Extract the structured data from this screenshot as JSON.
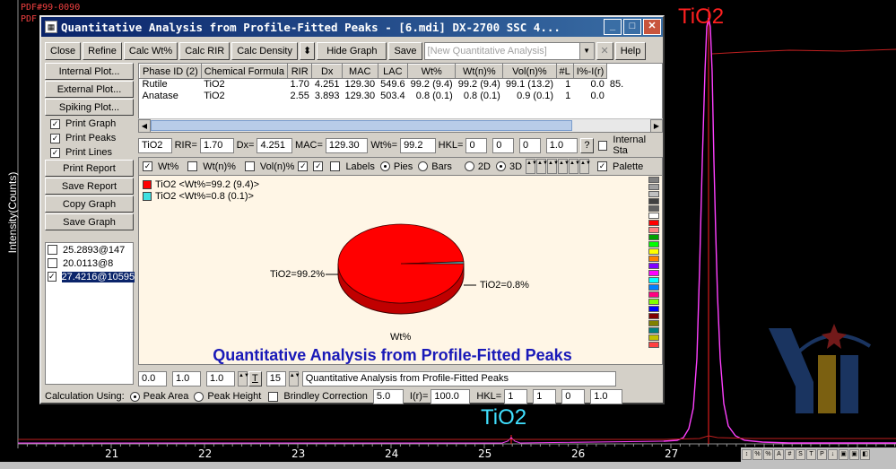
{
  "plot": {
    "pdf_label_1": "PDF#99-0090",
    "pdf_label_2": "PDF",
    "ylabel": "Intensity(Counts)",
    "peak_label_main": "TiO2",
    "peak_label_minor": "TiO2",
    "xticks": [
      "21",
      "22",
      "23",
      "24",
      "25",
      "26",
      "27"
    ],
    "colors": {
      "pattern": "#ff40ff",
      "peak_line": "#ff2020",
      "label_red": "#ff2020",
      "label_cyan": "#40e0ff"
    }
  },
  "dialog": {
    "title": "Quantitative Analysis from Profile-Fitted Peaks - [6.mdi] DX-2700 SSC 4...",
    "toolbar": {
      "close": "Close",
      "refine": "Refine",
      "calc_wt": "Calc Wt%",
      "calc_rir": "Calc RIR",
      "calc_density": "Calc Density",
      "hide_graph": "Hide Graph",
      "save": "Save",
      "new_qa": "[New Quantitative Analysis]",
      "help": "Help"
    },
    "left_buttons": {
      "internal_plot": "Internal Plot...",
      "external_plot": "External Plot...",
      "spiking_plot": "Spiking Plot...",
      "print_report": "Print Report",
      "save_report": "Save Report",
      "copy_graph": "Copy Graph",
      "save_graph": "Save Graph"
    },
    "left_checks": {
      "print_graph": "Print Graph",
      "print_peaks": "Print Peaks",
      "print_lines": "Print Lines"
    },
    "peaks": [
      {
        "label": "25.2893@147",
        "checked": false,
        "selected": false
      },
      {
        "label": "20.0113@8",
        "checked": false,
        "selected": false
      },
      {
        "label": "27.4216@10595",
        "checked": true,
        "selected": true
      }
    ],
    "table": {
      "headers": [
        "Phase ID (2)",
        "Chemical Formula",
        "RIR",
        "Dx",
        "MAC",
        "LAC",
        "Wt%",
        "Wt(n)%",
        "Vol(n)%",
        "#L",
        "I%-I(r)"
      ],
      "rows": [
        [
          "Rutile",
          "TiO2",
          "1.70",
          "4.251",
          "129.30",
          "549.6",
          "99.2 (9.4)",
          "99.2 (9.4)",
          "99.1 (13.2)",
          "1",
          "0.0",
          "85."
        ],
        [
          "Anatase",
          "TiO2",
          "2.55",
          "3.893",
          "129.30",
          "503.4",
          "0.8 (0.1)",
          "0.8 (0.1)",
          "0.9 (0.1)",
          "1",
          "0.0",
          ""
        ]
      ]
    },
    "params": {
      "formula": "TiO2",
      "rir_label": "RIR=",
      "rir": "1.70",
      "dx_label": "Dx=",
      "dx": "4.251",
      "mac_label": "MAC=",
      "mac": "129.30",
      "wt_label": "Wt%=",
      "wt": "99.2",
      "hkl_label": "HKL=",
      "hkl": [
        "0",
        "0",
        "0",
        "1.0"
      ],
      "help_q": "?",
      "internal_std": "Internal Sta"
    },
    "options": {
      "wt": "Wt%",
      "wtn": "Wt(n)%",
      "voln": "Vol(n)%",
      "labels": "Labels",
      "pies": "Pies",
      "bars": "Bars",
      "d2": "2D",
      "d3": "3D",
      "palette": "Palette"
    },
    "chart": {
      "legend": [
        {
          "text": "TiO2 <Wt%=99.2 (9.4)>",
          "color": "#ff0000"
        },
        {
          "text": "TiO2 <Wt%=0.8 (0.1)>",
          "color": "#40e0e0"
        }
      ],
      "slice_label_big": "TiO2=99.2%",
      "slice_label_small": "TiO2=0.8%",
      "caption": "Wt%",
      "title": "Quantitative Analysis from Profile-Fitted Peaks",
      "palette_colors": [
        "#808080",
        "#a0a0a0",
        "#c0c0c0",
        "#404040",
        "#606060",
        "#ffffff",
        "#ff0000",
        "#ff8080",
        "#00a000",
        "#00ff00",
        "#ffff00",
        "#ff8000",
        "#8000ff",
        "#ff00ff",
        "#00ffff",
        "#0080ff",
        "#ff0080",
        "#80ff00",
        "#0000ff",
        "#800000",
        "#808000",
        "#008080",
        "#c0c000",
        "#ff4040"
      ]
    },
    "chart_data": {
      "type": "pie",
      "categories": [
        "TiO2",
        "TiO2"
      ],
      "values": [
        99.2,
        0.8
      ],
      "title": "Quantitative Analysis from Profile-Fitted Peaks"
    },
    "bottom1": {
      "f1": "0.0",
      "f2": "1.0",
      "f3": "1.0",
      "t_label": "T",
      "f4": "15",
      "title_field": "Quantitative Analysis from Profile-Fitted Peaks"
    },
    "bottom2": {
      "calc_using": "Calculation Using:",
      "peak_area": "Peak Area",
      "peak_height": "Peak Height",
      "brindley": "Brindley Correction",
      "brindley_val": "5.0",
      "ir_label": "I(r)=",
      "ir_val": "100.0",
      "hkl_label": "HKL=",
      "hkl": [
        "1",
        "1",
        "0",
        "1.0"
      ]
    }
  }
}
